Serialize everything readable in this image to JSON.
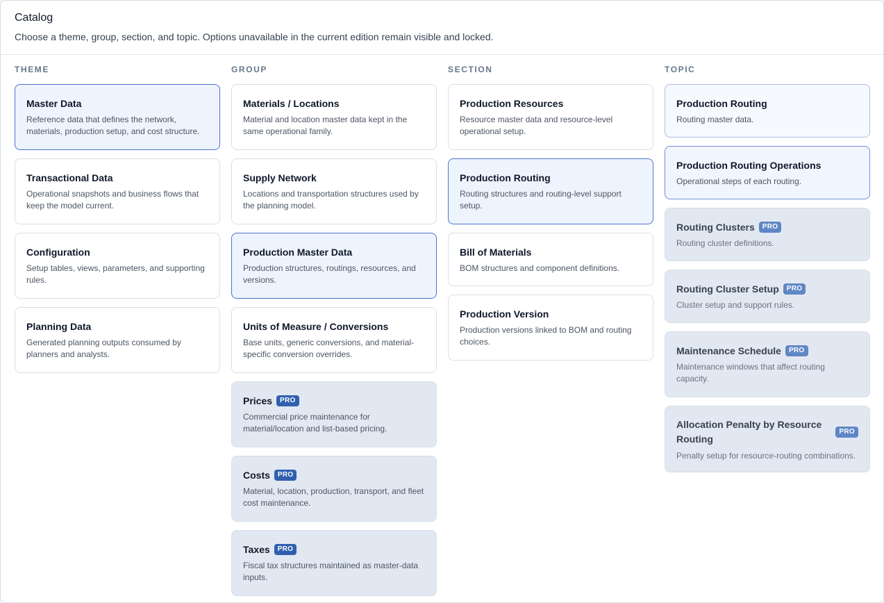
{
  "header": {
    "title": "Catalog",
    "subtitle": "Choose a theme, group, section, and topic. Options unavailable in the current edition remain visible and locked."
  },
  "columns": {
    "theme": {
      "label": "THEME",
      "items": [
        {
          "title": "Master Data",
          "desc": "Reference data that defines the network, materials, production setup, and cost structure."
        },
        {
          "title": "Transactional Data",
          "desc": "Operational snapshots and business flows that keep the model current."
        },
        {
          "title": "Configuration",
          "desc": "Setup tables, views, parameters, and supporting rules."
        },
        {
          "title": "Planning Data",
          "desc": "Generated planning outputs consumed by planners and analysts."
        }
      ]
    },
    "group": {
      "label": "GROUP",
      "items": [
        {
          "title": "Materials / Locations",
          "desc": "Material and location master data kept in the same operational family."
        },
        {
          "title": "Supply Network",
          "desc": "Locations and transportation structures used by the planning model."
        },
        {
          "title": "Production Master Data",
          "desc": "Production structures, routings, resources, and versions."
        },
        {
          "title": "Units of Measure / Conversions",
          "desc": "Base units, generic conversions, and material-specific conversion overrides."
        },
        {
          "title": "Prices",
          "badge": "PRO",
          "desc": "Commercial price maintenance for material/location and list-based pricing."
        },
        {
          "title": "Costs",
          "badge": "PRO",
          "desc": "Material, location, production, transport, and fleet cost maintenance."
        },
        {
          "title": "Taxes",
          "badge": "PRO",
          "desc": "Fiscal tax structures maintained as master-data inputs."
        }
      ]
    },
    "section": {
      "label": "SECTION",
      "items": [
        {
          "title": "Production Resources",
          "desc": "Resource master data and resource-level operational setup."
        },
        {
          "title": "Production Routing",
          "desc": "Routing structures and routing-level support setup."
        },
        {
          "title": "Bill of Materials",
          "desc": "BOM structures and component definitions."
        },
        {
          "title": "Production Version",
          "desc": "Production versions linked to BOM and routing choices."
        }
      ]
    },
    "topic": {
      "label": "TOPIC",
      "items": [
        {
          "title": "Production Routing",
          "desc": "Routing master data."
        },
        {
          "title": "Production Routing Operations",
          "desc": "Operational steps of each routing."
        },
        {
          "title": "Routing Clusters",
          "badge": "PRO",
          "desc": "Routing cluster definitions."
        },
        {
          "title": "Routing Cluster Setup",
          "badge": "PRO",
          "desc": "Cluster setup and support rules."
        },
        {
          "title": "Maintenance Schedule",
          "badge": "PRO",
          "desc": "Maintenance windows that affect routing capacity."
        },
        {
          "title": "Allocation Penalty by Resource Routing",
          "badge": "PRO",
          "desc": "Penalty setup for resource-routing combinations."
        }
      ]
    }
  },
  "colors": {
    "selected_border": "#4b72d1",
    "selected_bg": "#eef4fd",
    "locked_bg": "#e2e8f1",
    "pro_badge": "#2f5fae"
  }
}
